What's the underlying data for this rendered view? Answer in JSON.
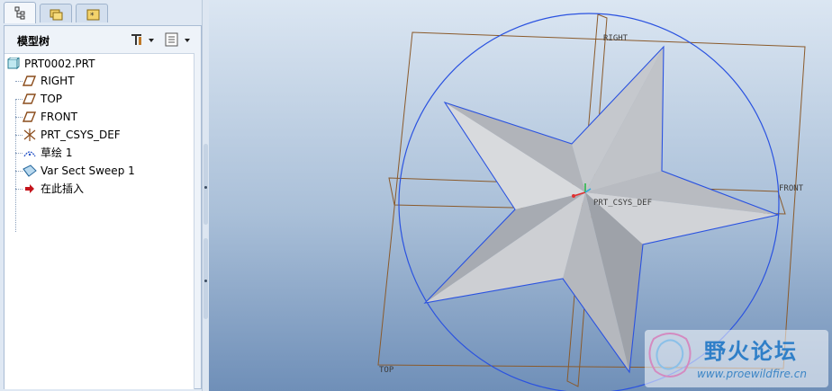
{
  "navigator": {
    "tabs": [
      {
        "icon": "model-tree-tab-icon",
        "active": true
      },
      {
        "icon": "folder-browser-tab-icon",
        "active": false
      },
      {
        "icon": "favorites-tab-icon",
        "active": false
      }
    ],
    "panel_title": "模型树",
    "settings_icon": "tools-icon",
    "show_icon": "list-settings-icon",
    "tree": [
      {
        "label": "PRT0002.PRT",
        "icon": "part-icon"
      },
      {
        "label": "RIGHT",
        "icon": "datum-plane-icon"
      },
      {
        "label": "TOP",
        "icon": "datum-plane-icon"
      },
      {
        "label": "FRONT",
        "icon": "datum-plane-icon"
      },
      {
        "label": "PRT_CSYS_DEF",
        "icon": "csys-icon"
      },
      {
        "label": "草绘 1",
        "icon": "sketch-icon"
      },
      {
        "label": "Var Sect Sweep 1",
        "icon": "sweep-icon"
      },
      {
        "label": "在此插入",
        "icon": "insert-here-arrow-icon"
      }
    ]
  },
  "viewport": {
    "datums": {
      "right": "RIGHT",
      "front": "FRONT",
      "top": "TOP",
      "csys": "PRT_CSYS_DEF"
    },
    "colors": {
      "datum_plane": "#8a5a2b",
      "sketch_circle": "#2a52e0",
      "star_face_light": "#d3d5d9",
      "star_face_dark": "#9da1a8",
      "background_top": "#dbe6f2",
      "background_bottom": "#6f8fb8"
    }
  },
  "watermark": {
    "title": "野火论坛",
    "url": "www.proewildfire.cn"
  }
}
